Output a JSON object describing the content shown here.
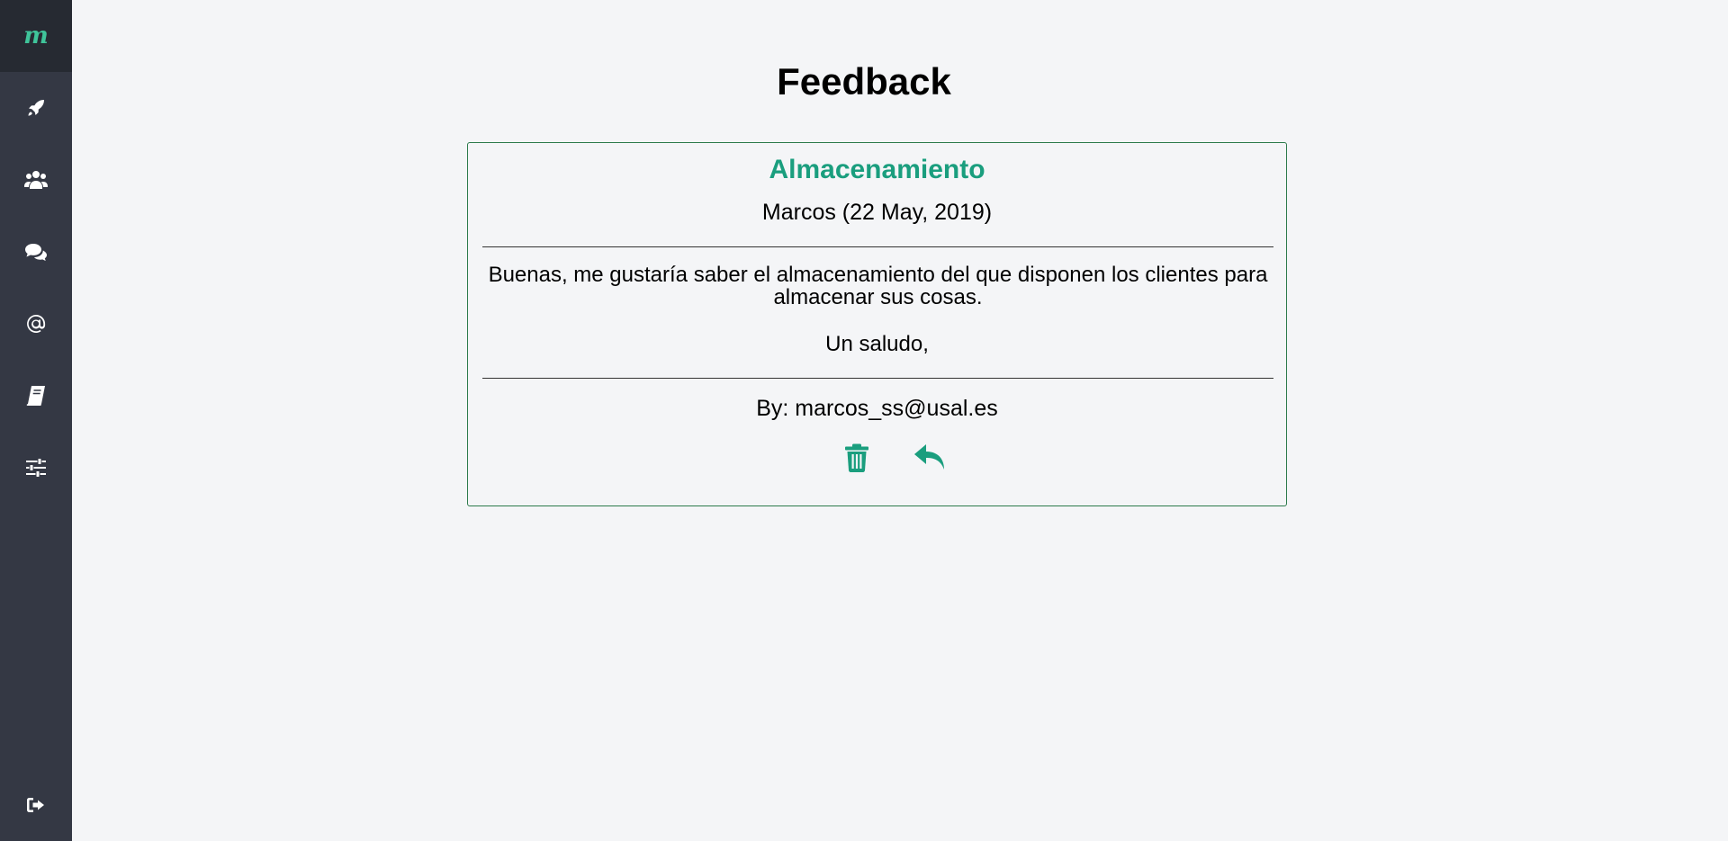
{
  "sidebar": {
    "logo_text": "m",
    "accent_color": "#3fc49a",
    "items": [
      {
        "icon": "rocket-icon"
      },
      {
        "icon": "users-icon"
      },
      {
        "icon": "chat-icon"
      },
      {
        "icon": "at-icon"
      },
      {
        "icon": "book-icon"
      },
      {
        "icon": "sliders-icon"
      }
    ],
    "logout_icon": "logout-icon"
  },
  "main": {
    "title": "Feedback",
    "feedback": {
      "subject": "Almacenamiento",
      "meta": "Marcos (22 May, 2019)",
      "body": "Buenas, me gustaría saber el almacenamiento del que disponen los clientes para almacenar sus cosas.",
      "signoff": "Un saludo,",
      "author": "By: marcos_ss@usal.es",
      "actions": [
        {
          "icon": "trash-icon"
        },
        {
          "icon": "reply-icon"
        }
      ],
      "accent_color": "#1a9e7e"
    }
  }
}
